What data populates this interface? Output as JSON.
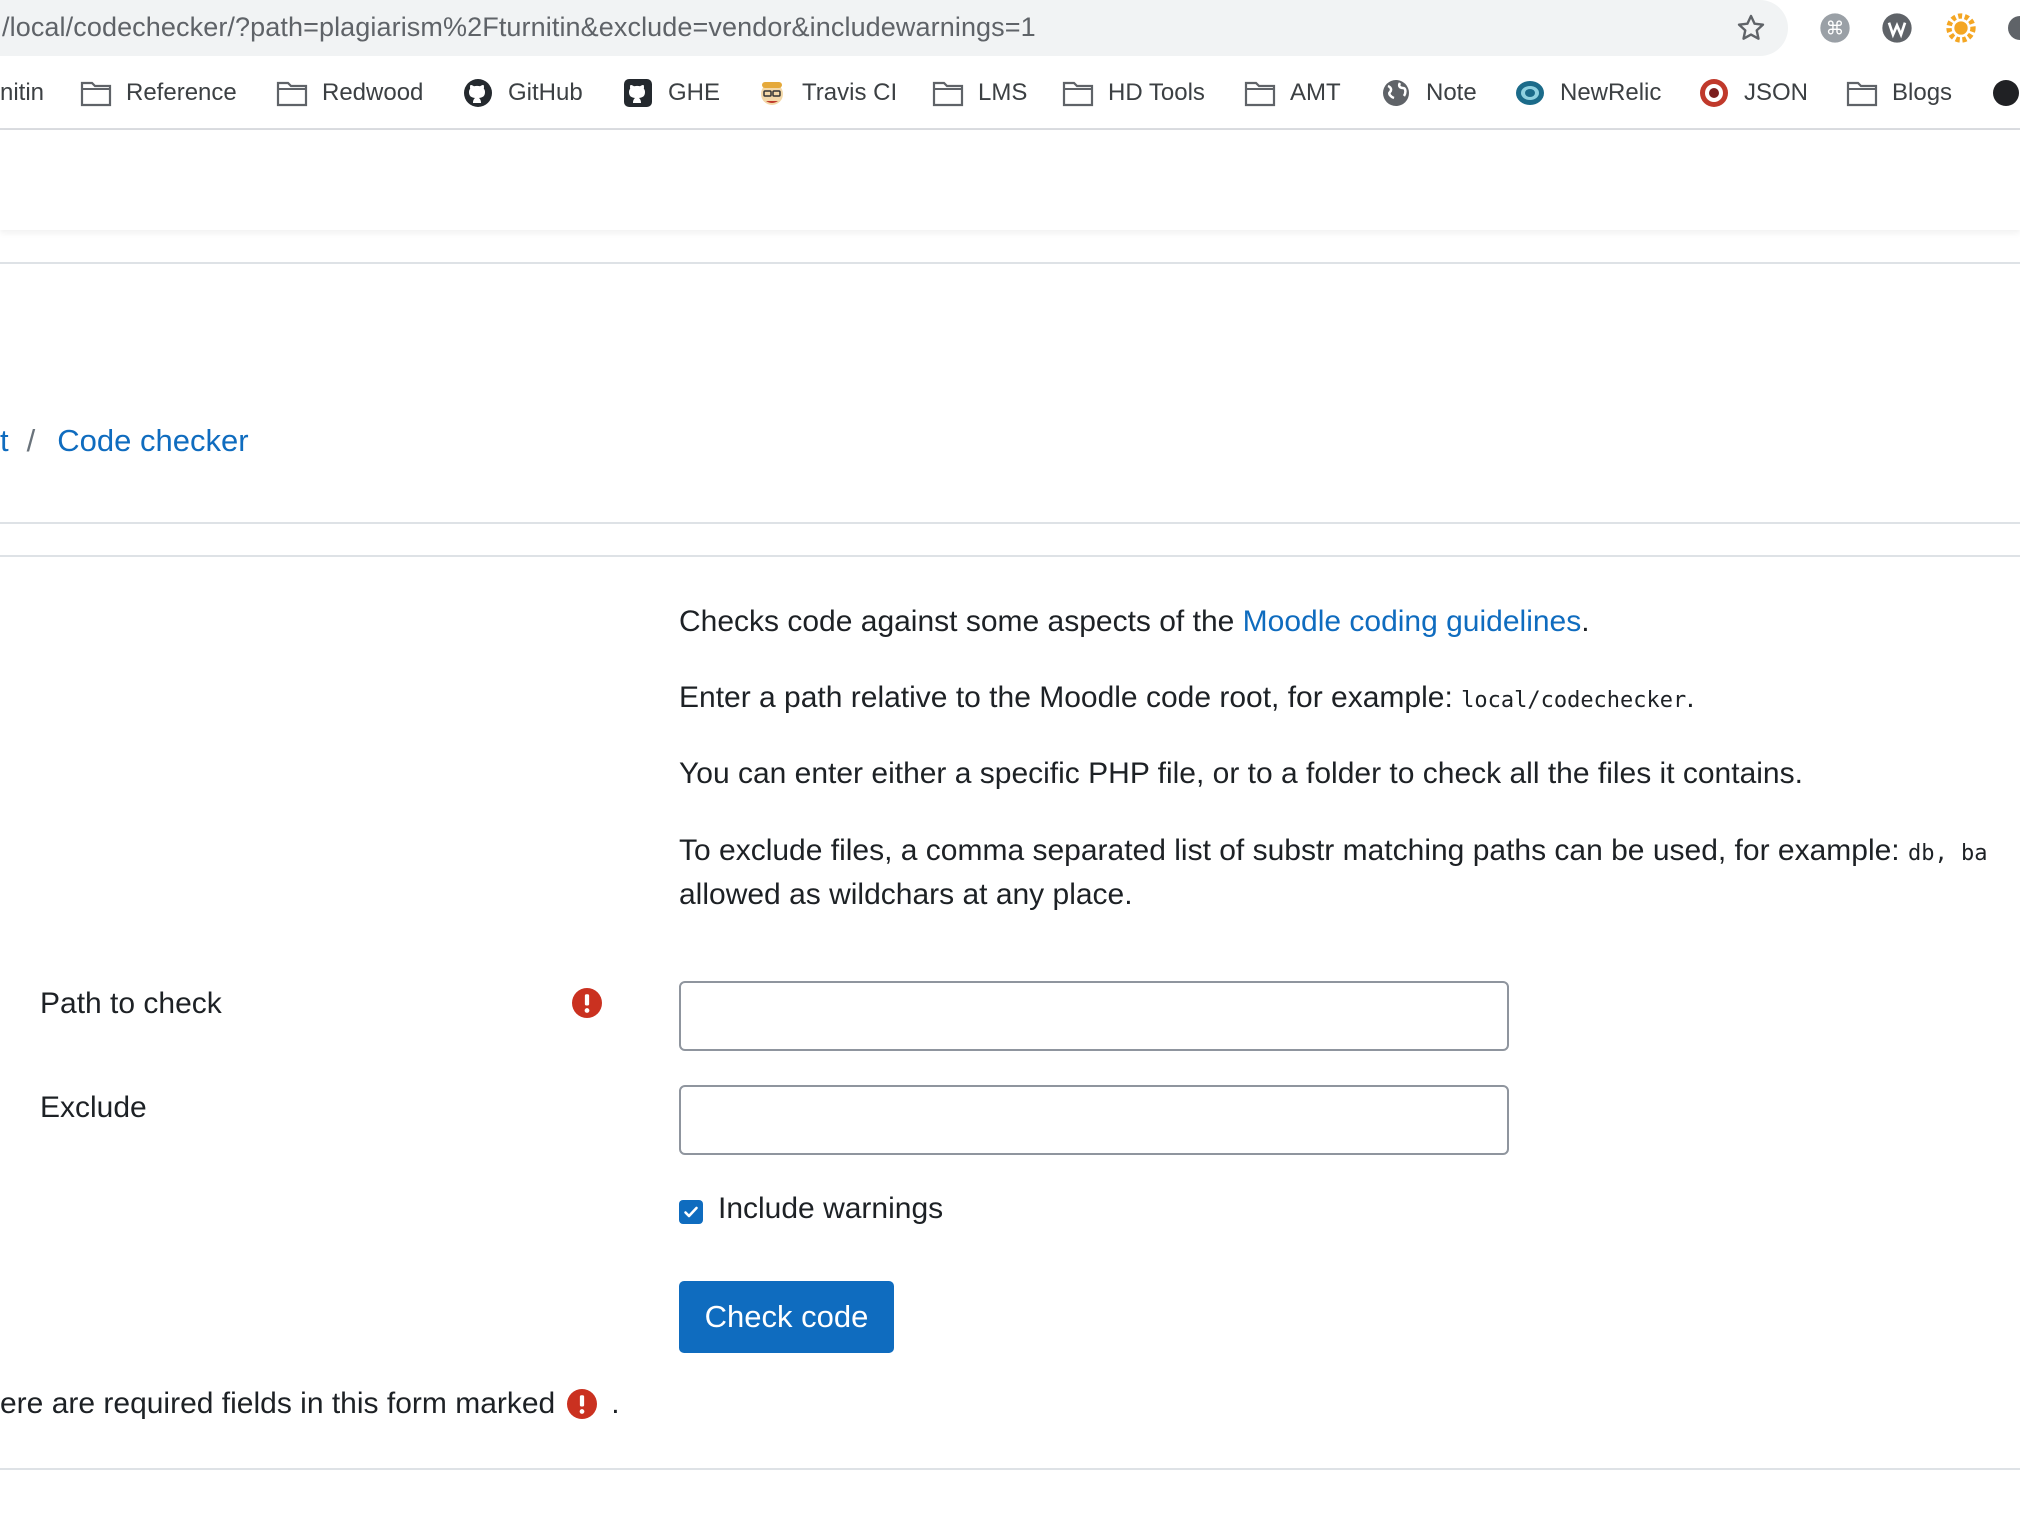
{
  "browser": {
    "url": "/local/codechecker/?path=plagiarism%2Fturnitin&exclude=vendor&includewarnings=1",
    "bookmarks": [
      {
        "label": "nitin",
        "icon": "none"
      },
      {
        "label": "Reference",
        "icon": "folder-icon"
      },
      {
        "label": "Redwood",
        "icon": "folder-icon"
      },
      {
        "label": "GitHub",
        "icon": "github-icon"
      },
      {
        "label": "GHE",
        "icon": "github-icon"
      },
      {
        "label": "Travis CI",
        "icon": "travis-icon"
      },
      {
        "label": "LMS",
        "icon": "folder-icon"
      },
      {
        "label": "HD Tools",
        "icon": "folder-icon"
      },
      {
        "label": "AMT",
        "icon": "folder-icon"
      },
      {
        "label": "Note",
        "icon": "globe-icon"
      },
      {
        "label": "NewRelic",
        "icon": "newrelic-icon"
      },
      {
        "label": "JSON",
        "icon": "json-icon"
      },
      {
        "label": "Blogs",
        "icon": "folder-icon"
      }
    ]
  },
  "breadcrumb": {
    "prev": "t",
    "separator": "/",
    "current": "Code checker"
  },
  "intro": {
    "p1_before": "Checks code against some aspects of the ",
    "p1_link": "Moodle coding guidelines",
    "p1_after": ".",
    "p2_text": "Enter a path relative to the Moodle code root, for example: ",
    "p2_code": "local/codechecker",
    "p2_after": ".",
    "p3_text": "You can enter either a specific PHP file, or to a folder to check all the files it contains.",
    "p4_text": "To exclude files, a comma separated list of substr matching paths can be used, for example: ",
    "p4_code": "db, ba",
    "p4_line2": "allowed as wildchars at any place."
  },
  "form": {
    "path_label": "Path to check",
    "path_value": "",
    "exclude_label": "Exclude",
    "exclude_value": "",
    "include_warnings_label": "Include warnings",
    "include_warnings_checked": true,
    "submit_label": "Check code",
    "required_note": "ere are required fields in this form marked",
    "required_note_end": "."
  }
}
